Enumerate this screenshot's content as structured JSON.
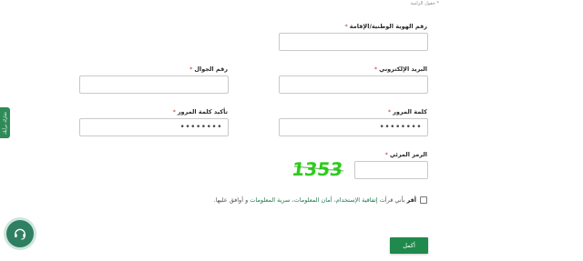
{
  "form": {
    "required_note": "* حقول الزامية",
    "required_mark": "*",
    "national_id": {
      "label": "رقم الهوية الوطنية/الإقامة",
      "value": ""
    },
    "email": {
      "label": "البريد الإلكتروني",
      "value": ""
    },
    "mobile": {
      "label": "رقم الجوال",
      "value": ""
    },
    "password": {
      "label": "كلمة المرور",
      "value": "••••••••"
    },
    "confirm_password": {
      "label": "تأكيد كلمة المرور",
      "value": "••••••••"
    },
    "captcha": {
      "label": "الرمز المرئي",
      "image_text": "1353",
      "value": ""
    },
    "consent": {
      "part1": "أقر",
      "part2": "بأني قرأت",
      "link1": "إتفاقية الإستخدام",
      "sep1": "،",
      "link2": "أمان المعلومات",
      "sep2": "،",
      "link3": "سرية المعلومات",
      "part3": "و أوافق عليها."
    },
    "next_button": "أكمل"
  },
  "side_tab": {
    "label": "شارك برأيك"
  },
  "colors": {
    "primary": "#1f8a4c",
    "required": "#c0392b",
    "link": "#1e7b4f",
    "captcha": "#2ecc1e"
  },
  "icons": {
    "support": "headset-icon"
  }
}
